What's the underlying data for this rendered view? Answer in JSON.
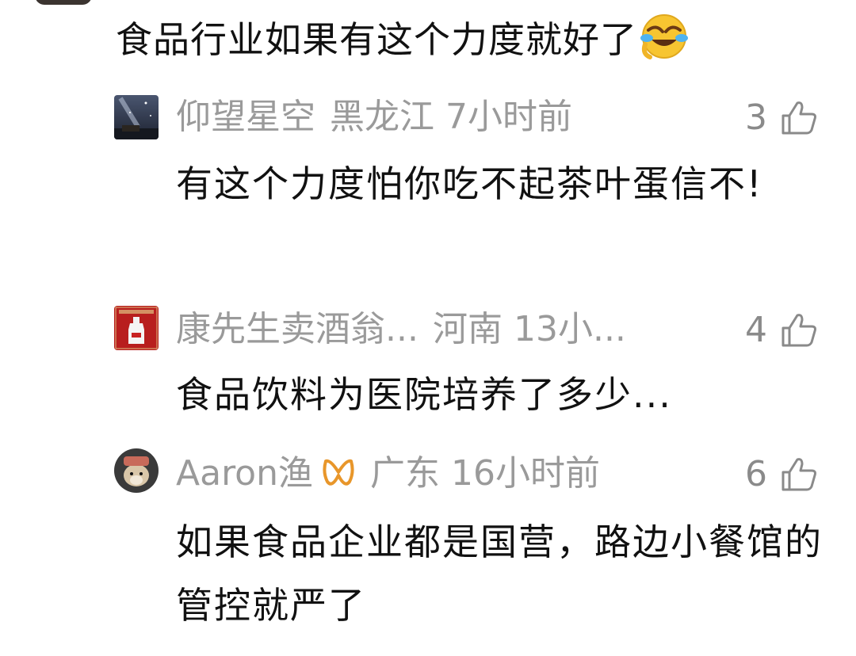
{
  "parent_comment": {
    "text": "食品行业如果有这个力度就好了",
    "emoji": "crying-laughing-emoji"
  },
  "replies": [
    {
      "username": "仰望星空",
      "location": "黑龙江",
      "time": "7小时前",
      "likes": "3",
      "text": "有这个力度怕你吃不起茶叶蛋信不!"
    },
    {
      "username": "康先生卖酒翁...",
      "location": "河南",
      "time": "13小...",
      "likes": "4",
      "text": "食品饮料为医院培养了多少..."
    },
    {
      "username": "Aaron渔",
      "badge": "infinity-badge-icon",
      "location": "广东",
      "time": "16小时前",
      "likes": "6",
      "text": "如果食品企业都是国营，路边小餐馆的管控就严了"
    }
  ],
  "colors": {
    "meta_text": "#9a9a9a",
    "body_text": "#111111",
    "badge": "#e8962a"
  }
}
